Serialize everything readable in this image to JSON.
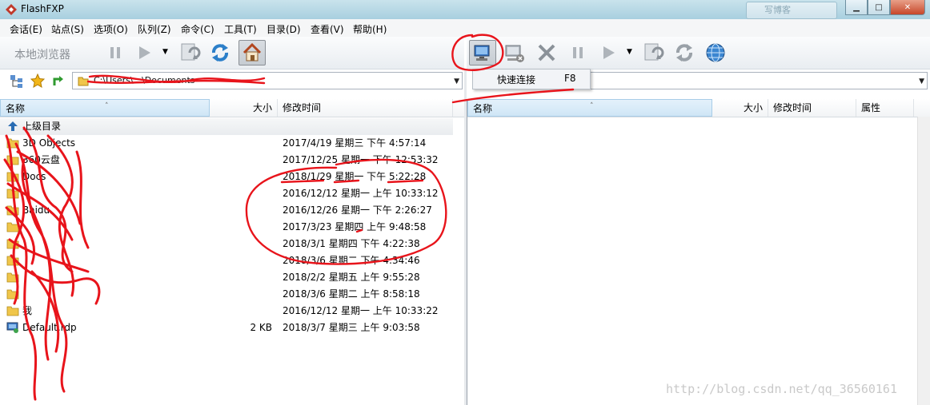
{
  "window": {
    "title": "FlashFXP",
    "ghost_button": "写博客"
  },
  "menu": [
    "会话(E)",
    "站点(S)",
    "选项(O)",
    "队列(Z)",
    "命令(C)",
    "工具(T)",
    "目录(D)",
    "查看(V)",
    "帮助(H)"
  ],
  "toolbar_left": {
    "local_browser": "本地浏览器"
  },
  "quick_connect": {
    "label": "快速连接",
    "shortcut": "F8"
  },
  "left_pane": {
    "path": "C:\\Users\\...\\Documents",
    "columns": {
      "name": "名称",
      "size": "大小",
      "modified": "修改时间"
    },
    "parent_label": "上级目录",
    "rows": [
      {
        "name": "3D Objects",
        "size": "",
        "modified": "2017/4/19 星期三 下午 4:57:14",
        "type": "folder"
      },
      {
        "name": "360云盘",
        "size": "",
        "modified": "2017/12/25 星期一 下午 12:53:32",
        "type": "folder"
      },
      {
        "name": "Docs",
        "size": "",
        "modified": "2018/1/29 星期一 下午 5:22:28",
        "type": "folder"
      },
      {
        "name": "",
        "size": "",
        "modified": "2016/12/12 星期一 上午 10:33:12",
        "type": "folder"
      },
      {
        "name": "Baidu",
        "size": "",
        "modified": "2016/12/26 星期一 下午 2:26:27",
        "type": "folder"
      },
      {
        "name": "",
        "size": "",
        "modified": "2017/3/23 星期四 上午 9:48:58",
        "type": "folder"
      },
      {
        "name": "",
        "size": "",
        "modified": "2018/3/1 星期四 下午 4:22:38",
        "type": "folder"
      },
      {
        "name": "",
        "size": "",
        "modified": "2018/3/6 星期二 下午 4:34:46",
        "type": "folder"
      },
      {
        "name": "",
        "size": "",
        "modified": "2018/2/2 星期五 上午 9:55:28",
        "type": "folder"
      },
      {
        "name": "",
        "size": "",
        "modified": "2018/3/6 星期二 上午 8:58:18",
        "type": "folder"
      },
      {
        "name": "我",
        "size": "",
        "modified": "2016/12/12 星期一 上午 10:33:22",
        "type": "folder"
      },
      {
        "name": "Default.rdp",
        "size": "2 KB",
        "modified": "2018/3/7 星期三 上午 9:03:58",
        "type": "file"
      }
    ]
  },
  "right_pane": {
    "columns": {
      "name": "名称",
      "size": "大小",
      "modified": "修改时间",
      "attributes": "属性"
    }
  },
  "watermark": "http://blog.csdn.net/qq_36560161",
  "colors": {
    "annotation": "#e8141b",
    "folder": "#f0c64a",
    "titlebar": "#b8d8e6"
  }
}
